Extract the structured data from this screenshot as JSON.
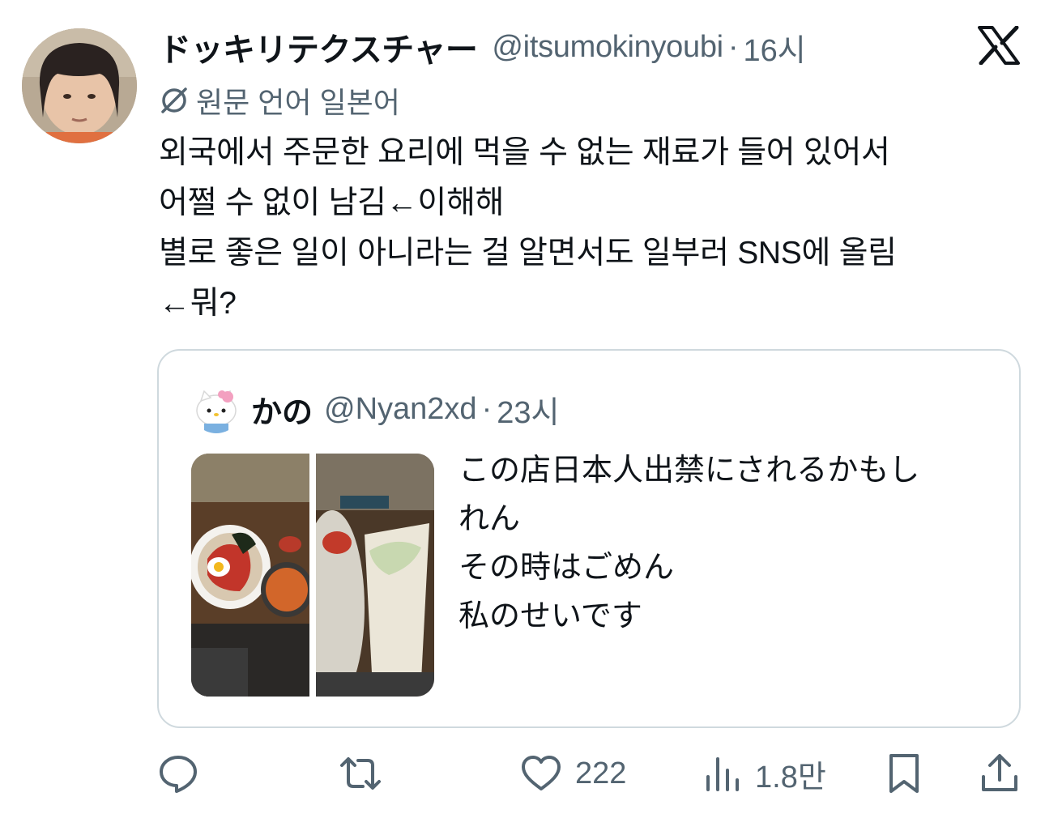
{
  "tweet": {
    "author_name": "ドッキリテクスチャー",
    "author_handle": "@itsumokinyoubi",
    "separator": "·",
    "time": "16시",
    "translate_label": "원문 언어 일본어",
    "body_lines": [
      "외국에서 주문한 요리에 먹을 수 없는 재료가 들어 있어서",
      "어쩔 수 없이 남김←이해해",
      "별로 좋은 일이 아니라는 걸 알면서도 일부러 SNS에 올림",
      "←뭐?"
    ]
  },
  "quoted": {
    "author_name": "かの",
    "author_handle": "@Nyan2xd",
    "separator": "·",
    "time": "23시",
    "text_lines": [
      "この店日本人出禁にされるかもし",
      "れん",
      "その時はごめん",
      "私のせいです"
    ]
  },
  "actions": {
    "reply_count": "",
    "retweet_count": "",
    "like_count": "222",
    "views_count": "1.8만"
  },
  "icons": {
    "platform": "x-logo-icon",
    "translate": "translate-icon",
    "reply": "reply-icon",
    "retweet": "retweet-icon",
    "like": "heart-icon",
    "views": "views-bar-chart-icon",
    "bookmark": "bookmark-icon",
    "share": "share-icon"
  },
  "colors": {
    "text_primary": "#0f1419",
    "text_secondary": "#536471",
    "border": "#cfd9de"
  }
}
